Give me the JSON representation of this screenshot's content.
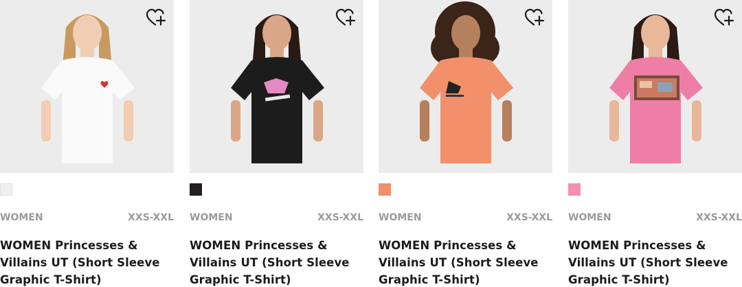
{
  "products": [
    {
      "color_name": "white",
      "swatch_color": "#f0f0f0",
      "shirt_color": "#fafafa",
      "skin_color": "#f1cdb4",
      "hair_color": "#c89a5f",
      "gender": "WOMEN",
      "size_range": "XXS-XXL",
      "title": "WOMEN Princesses & Villains UT (Short Sleeve Graphic T-Shirt)",
      "favorite_icon": "heart-plus-icon"
    },
    {
      "color_name": "black",
      "swatch_color": "#231f20",
      "shirt_color": "#1c1c1c",
      "skin_color": "#d9a787",
      "hair_color": "#2a1a14",
      "gender": "WOMEN",
      "size_range": "XXS-XXL",
      "title": "WOMEN Princesses & Villains UT (Short Sleeve Graphic T-Shirt)",
      "favorite_icon": "heart-plus-icon"
    },
    {
      "color_name": "orange",
      "swatch_color": "#f0906a",
      "shirt_color": "#f2906c",
      "skin_color": "#b5805e",
      "hair_color": "#3b2418",
      "gender": "WOMEN",
      "size_range": "XXS-XXL",
      "title": "WOMEN Princesses & Villains UT (Short Sleeve Graphic T-Shirt)",
      "favorite_icon": "heart-plus-icon"
    },
    {
      "color_name": "pink",
      "swatch_color": "#f38fb2",
      "shirt_color": "#ee7ea6",
      "skin_color": "#e7b89a",
      "hair_color": "#2b1b15",
      "gender": "WOMEN",
      "size_range": "XXS-XXL",
      "title": "WOMEN Princesses & Villains UT (Short Sleeve Graphic T-Shirt)",
      "favorite_icon": "heart-plus-icon"
    }
  ]
}
